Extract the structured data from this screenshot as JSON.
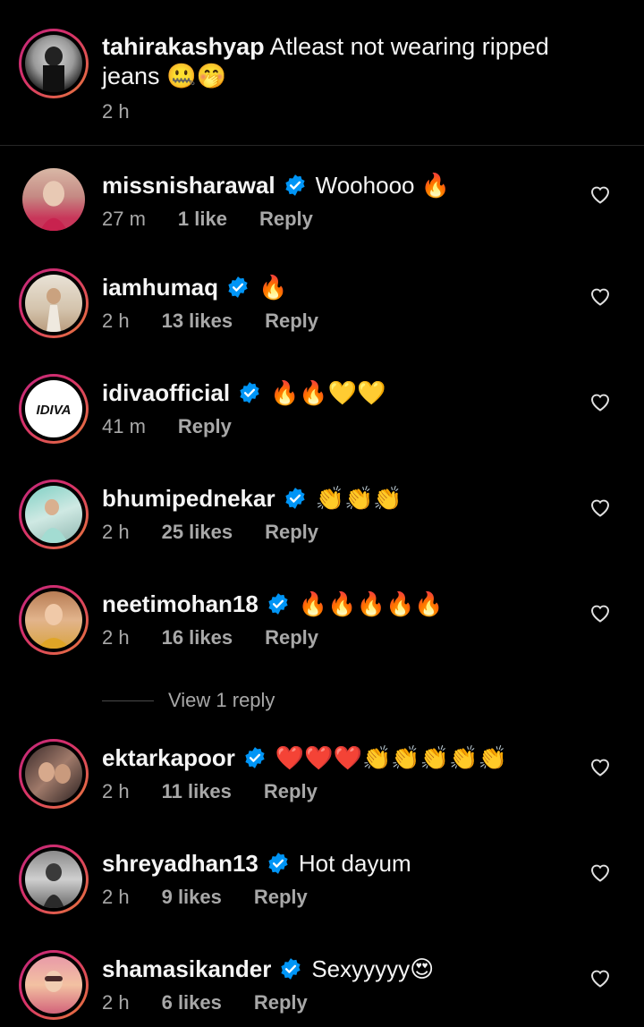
{
  "caption": {
    "username": "tahirakashyap",
    "text": "Atleast not wearing ripped jeans 🤐🤭",
    "time": "2 h"
  },
  "comments": [
    {
      "username": "missnisharawal",
      "verified": true,
      "text": "Woohooo 🔥",
      "time": "27 m",
      "likes": "1 like",
      "reply": "Reply"
    },
    {
      "username": "iamhumaq",
      "verified": true,
      "text": "🔥",
      "time": "2 h",
      "likes": "13 likes",
      "reply": "Reply"
    },
    {
      "username": "idivaofficial",
      "verified": true,
      "text": "🔥🔥💛💛",
      "time": "41 m",
      "likes": "",
      "reply": "Reply"
    },
    {
      "username": "bhumipednekar",
      "verified": true,
      "text": "👏👏👏",
      "time": "2 h",
      "likes": "25 likes",
      "reply": "Reply"
    },
    {
      "username": "neetimohan18",
      "verified": true,
      "text": "🔥🔥🔥🔥🔥",
      "time": "2 h",
      "likes": "16 likes",
      "reply": "Reply"
    },
    {
      "username": "ektarkapoor",
      "verified": true,
      "text": "❤️❤️❤️👏👏👏👏👏",
      "time": "2 h",
      "likes": "11 likes",
      "reply": "Reply"
    },
    {
      "username": "shreyadhan13",
      "verified": true,
      "text": "Hot dayum",
      "time": "2 h",
      "likes": "9 likes",
      "reply": "Reply"
    },
    {
      "username": "shamasikander",
      "verified": true,
      "text": "Sexyyyyy😍",
      "time": "2 h",
      "likes": "6 likes",
      "reply": "Reply"
    }
  ],
  "view_replies": "View 1 reply",
  "colors": {
    "background": "#000000",
    "text_primary": "#f5f5f5",
    "text_secondary": "#a8a8a8",
    "verified_blue": "#0095f6",
    "story_ring_start": "#c02a7a",
    "story_ring_end": "#e87a3a"
  },
  "icons": {
    "verified": "verified-badge-icon",
    "like": "heart-outline-icon"
  }
}
